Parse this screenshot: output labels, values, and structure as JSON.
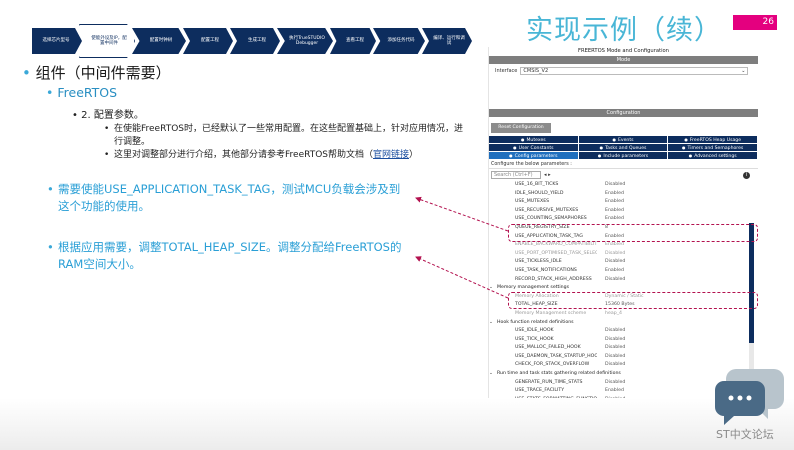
{
  "header": {
    "title": "实现示例（续）",
    "page_number": "26"
  },
  "steps": [
    "选择芯片型号",
    "使能外设及IP，配置中间件",
    "配置时钟树",
    "配置工程",
    "生成工程",
    "执行TrueSTUDIO Debugger",
    "查看工程",
    "添加任务代码",
    "编译、运行和调试"
  ],
  "content": {
    "bullet1": "组件（中间件需要）",
    "bullet2": "FreeRTOS",
    "bullet3": "2. 配置参数。",
    "sub1": "在使能FreeRTOS时，已经默认了一些常用配置。在这些配置基础上，针对应用情况，进行调整。",
    "sub2_text": "这里对调整部分进行介绍，其他部分请参考FreeRTOS帮助文档（",
    "sub2_link": "官网链接",
    "sub2_end": "）",
    "callout1": "需要使能USE_APPLICATION_TASK_TAG，测试MCU负载会涉及到这个功能的使用。",
    "callout2": "根据应用需要，调整TOTAL_HEAP_SIZE。调整分配给FreeRTOS的RAM空间大小。"
  },
  "panel": {
    "title": "FREERTOS Mode and Configuration",
    "mode_label": "Mode",
    "interface_label": "Interface",
    "interface_value": "CMSIS_V2",
    "config_label": "Configuration",
    "reset_button": "Reset Configuration",
    "tabs_row1": [
      "Mutexes",
      "Events",
      "FreeRTOS Heap Usage"
    ],
    "tabs_row2": [
      "User Constants",
      "Tasks and Queues",
      "Timers and Semaphores"
    ],
    "tabs_row3": [
      "Config parameters",
      "Include parameters",
      "Advanced settings"
    ],
    "configure_text": "Configure the below parameters :",
    "search_placeholder": "Search (Ctrl+F)",
    "params": [
      {
        "name": "USE_16_BIT_TICKS",
        "value": "Disabled"
      },
      {
        "name": "IDLE_SHOULD_YIELD",
        "value": "Enabled"
      },
      {
        "name": "USE_MUTEXES",
        "value": "Enabled"
      },
      {
        "name": "USE_RECURSIVE_MUTEXES",
        "value": "Enabled"
      },
      {
        "name": "USE_COUNTING_SEMAPHORES",
        "value": "Enabled"
      },
      {
        "name": "QUEUE_REGISTRY_SIZE",
        "value": "8"
      },
      {
        "name": "USE_APPLICATION_TASK_TAG",
        "value": "Enabled"
      },
      {
        "name": "ENABLE_BACKWARD_COMPATIBILITY",
        "value": "Enabled"
      },
      {
        "name": "USE_PORT_OPTIMISED_TASK_SELECTION",
        "value": "Disabled"
      },
      {
        "name": "USE_TICKLESS_IDLE",
        "value": "Disabled"
      },
      {
        "name": "USE_TASK_NOTIFICATIONS",
        "value": "Enabled"
      },
      {
        "name": "RECORD_STACK_HIGH_ADDRESS",
        "value": "Disabled"
      },
      {
        "name": "Memory management settings",
        "value": "",
        "group": true
      },
      {
        "name": "Memory Allocation",
        "value": "Dynamic / Static"
      },
      {
        "name": "TOTAL_HEAP_SIZE",
        "value": "15360 Bytes"
      },
      {
        "name": "Memory Management scheme",
        "value": "heap_4"
      },
      {
        "name": "Hook function related definitions",
        "value": "",
        "group": true
      },
      {
        "name": "USE_IDLE_HOOK",
        "value": "Disabled"
      },
      {
        "name": "USE_TICK_HOOK",
        "value": "Disabled"
      },
      {
        "name": "USE_MALLOC_FAILED_HOOK",
        "value": "Disabled"
      },
      {
        "name": "USE_DAEMON_TASK_STARTUP_HOOK",
        "value": "Disabled"
      },
      {
        "name": "CHECK_FOR_STACK_OVERFLOW",
        "value": "Disabled"
      },
      {
        "name": "Run time and task stats gathering related definitions",
        "value": "",
        "group": true
      },
      {
        "name": "GENERATE_RUN_TIME_STATS",
        "value": "Disabled"
      },
      {
        "name": "USE_TRACE_FACILITY",
        "value": "Enabled"
      },
      {
        "name": "USE_STATS_FORMATTING_FUNCTIONS",
        "value": "Disabled"
      }
    ]
  },
  "footer": {
    "logo_text": "ST中文论坛"
  },
  "colors": {
    "title": "#49b6d6",
    "accent": "#e4007f",
    "navy": "#0d2d5e",
    "callout": "#2a9fd6",
    "highlight": "#b3124f"
  }
}
